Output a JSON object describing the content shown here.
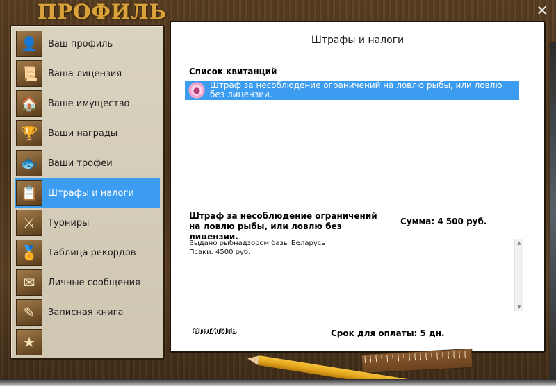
{
  "window": {
    "title": "ПРОФИЛЬ",
    "close_label": "✕"
  },
  "sidebar": {
    "items": [
      {
        "label": "Ваш профиль",
        "icon": "user-avatar-icon",
        "glyph": "👤",
        "active": false
      },
      {
        "label": "Ваша лицензия",
        "icon": "license-document-icon",
        "glyph": "📜",
        "active": false
      },
      {
        "label": "Ваше имущество",
        "icon": "property-house-icon",
        "glyph": "🏠",
        "active": false
      },
      {
        "label": "Ваши награды",
        "icon": "trophy-cup-icon",
        "glyph": "🏆",
        "active": false
      },
      {
        "label": "Ваши трофеи",
        "icon": "fish-trophy-icon",
        "glyph": "🐟",
        "active": false
      },
      {
        "label": "Штрафы и налоги",
        "icon": "fine-notice-icon",
        "glyph": "📋",
        "active": true
      },
      {
        "label": "Турниры",
        "icon": "crossed-swords-icon",
        "glyph": "⚔",
        "active": false
      },
      {
        "label": "Таблица рекордов",
        "icon": "record-medal-icon",
        "glyph": "🏅",
        "active": false
      },
      {
        "label": "Личные сообщения",
        "icon": "envelope-icon",
        "glyph": "✉",
        "active": false
      },
      {
        "label": "Записная книга",
        "icon": "notebook-pencil-icon",
        "glyph": "✎",
        "active": false
      },
      {
        "label": "",
        "icon": "ads-banner-icon",
        "glyph": "★",
        "active": false
      }
    ]
  },
  "main": {
    "title": "Штрафы и налоги",
    "list_header": "Список квитанций",
    "receipts": [
      {
        "text": "Штраф за несоблюдение ограничений на ловлю рыбы, или ловлю без лицензии.",
        "icon": "piggy-bank-icon",
        "selected": true
      }
    ],
    "detail": {
      "title": "Штраф за несоблюдение ограничений на ловлю рыбы, или ловлю без лицензии.",
      "amount": "Сумма: 4 500 руб.",
      "description_line1": "Выдано рыбнадзором базы Беларусь",
      "description_line2": "Псаки. 4500 руб.",
      "pay_label": "ОПЛАТИТЬ",
      "due": "Срок для оплаты: 5 дн."
    }
  },
  "colors": {
    "selection": "#3c9cf0",
    "title_gold": "#d9a23a",
    "panel_bg": "#ffffff"
  }
}
